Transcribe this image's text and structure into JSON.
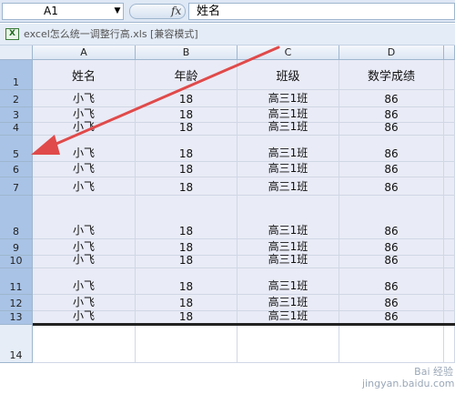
{
  "formula_bar": {
    "cell_ref": "A1",
    "dropdown_glyph": "▼",
    "fx_label": "fx",
    "value": "姓名"
  },
  "workbook": {
    "icon_label": "X",
    "title": "excel怎么统一调整行高.xls [兼容模式]"
  },
  "columns": [
    "A",
    "B",
    "C",
    "D"
  ],
  "rows": [
    {
      "num": "1",
      "cells": [
        "姓名",
        "年龄",
        "班级",
        "数学成绩"
      ]
    },
    {
      "num": "2",
      "cells": [
        "小飞",
        "18",
        "高三1班",
        "86"
      ]
    },
    {
      "num": "3",
      "cells": [
        "小飞",
        "18",
        "高三1班",
        "86"
      ]
    },
    {
      "num": "4",
      "cells": [
        "小飞",
        "18",
        "高三1班",
        "86"
      ]
    },
    {
      "num": "5",
      "cells": [
        "小飞",
        "18",
        "高三1班",
        "86"
      ]
    },
    {
      "num": "6",
      "cells": [
        "小飞",
        "18",
        "高三1班",
        "86"
      ]
    },
    {
      "num": "7",
      "cells": [
        "小飞",
        "18",
        "高三1班",
        "86"
      ]
    },
    {
      "num": "8",
      "cells": [
        "小飞",
        "18",
        "高三1班",
        "86"
      ]
    },
    {
      "num": "9",
      "cells": [
        "小飞",
        "18",
        "高三1班",
        "86"
      ]
    },
    {
      "num": "10",
      "cells": [
        "小飞",
        "18",
        "高三1班",
        "86"
      ]
    },
    {
      "num": "11",
      "cells": [
        "小飞",
        "18",
        "高三1班",
        "86"
      ]
    },
    {
      "num": "12",
      "cells": [
        "小飞",
        "18",
        "高三1班",
        "86"
      ]
    },
    {
      "num": "13",
      "cells": [
        "小飞",
        "18",
        "高三1班",
        "86"
      ]
    },
    {
      "num": "14",
      "cells": [
        "",
        "",
        "",
        ""
      ]
    }
  ],
  "selected_rows": [
    "1",
    "2",
    "3",
    "4",
    "5",
    "6",
    "7",
    "8",
    "9",
    "10",
    "11",
    "12",
    "13"
  ],
  "annotation": {
    "type": "red-arrow",
    "color": "#e04a4a"
  },
  "watermark": {
    "line1": "Bai 经验",
    "line2": "jingyan.baidu.com"
  },
  "colors": {
    "header_bg": "#dfe8f5",
    "selection": "#e9ebf6",
    "row_header_selected": "#a9c3e6",
    "arrow": "#e04a4a"
  }
}
